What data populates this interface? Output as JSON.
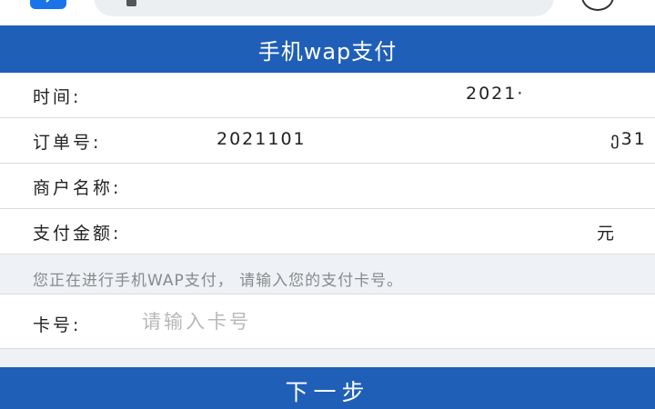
{
  "header": {
    "title": "手机wap支付"
  },
  "order_info": {
    "time_label": "时间:",
    "time_value": "2021·",
    "order_no_label": "订单号:",
    "order_no_value_start": "2021101",
    "order_no_value_end": "ე31",
    "merchant_label": "商户名称:",
    "amount_label": "支付金额:",
    "amount_unit": "元"
  },
  "notice": {
    "text": "您正在进行手机WAP支付， 请输入您的支付卡号。"
  },
  "card": {
    "label": "卡号:",
    "placeholder": "请输入卡号",
    "value": ""
  },
  "actions": {
    "next_label": "下一步"
  },
  "colors": {
    "primary": "#1f5fb8",
    "notice_bg": "#eef1f6",
    "placeholder": "#b8b8b8"
  }
}
